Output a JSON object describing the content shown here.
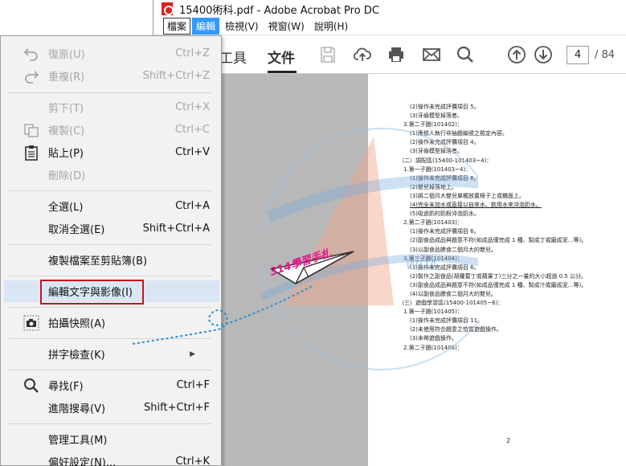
{
  "window": {
    "title": "15400術科.pdf - Adobe Acrobat Pro DC",
    "menubar": [
      "檔案",
      "編輯",
      "檢視(V)",
      "視窗(W)",
      "說明(H)"
    ]
  },
  "toolbar": {
    "tab_tools": "工具",
    "tab_document": "文件",
    "page_current": "4",
    "page_total": "/ 84"
  },
  "edit_menu": {
    "undo": {
      "label": "復原(U)",
      "shortcut": "Ctrl+Z"
    },
    "redo": {
      "label": "重複(R)",
      "shortcut": "Shift+Ctrl+Z"
    },
    "cut": {
      "label": "剪下(T)",
      "shortcut": "Ctrl+X"
    },
    "copy": {
      "label": "複製(C)",
      "shortcut": "Ctrl+C"
    },
    "paste": {
      "label": "貼上(P)",
      "shortcut": "Ctrl+V"
    },
    "delete": {
      "label": "刪除(D)",
      "shortcut": ""
    },
    "select_all": {
      "label": "全選(L)",
      "shortcut": "Ctrl+A"
    },
    "deselect_all": {
      "label": "取消全選(E)",
      "shortcut": "Shift+Ctrl+A"
    },
    "copy_file": {
      "label": "複製檔案至剪貼簿(B)",
      "shortcut": ""
    },
    "edit_text_images": {
      "label": "編輯文字與影像(I)",
      "shortcut": ""
    },
    "snapshot": {
      "label": "拍攝快照(A)",
      "shortcut": ""
    },
    "spell_check": {
      "label": "拼字檢查(K)",
      "shortcut": ""
    },
    "find": {
      "label": "尋找(F)",
      "shortcut": "Ctrl+F"
    },
    "advanced_search": {
      "label": "進階搜尋(V)",
      "shortcut": "Shift+Ctrl+F"
    },
    "manage_tools": {
      "label": "管理工具(M)",
      "shortcut": ""
    },
    "preferences": {
      "label": "偏好設定(N)...",
      "shortcut": "Ctrl+K"
    }
  },
  "pdf": {
    "lines": [
      "(2)操作未完成評價項目 5。",
      "(3)牙齒模型掉落者。",
      "3.第二子題(101402)：",
      "(1)應檢人執行非抽題編號之檢定內容。",
      "(2)操作未完成評價項目 4。",
      "(3)牙齒模型掉落者。",
      "（二）調配區(15400-101403~4)：",
      "1.第一子題(101403~4)：",
      "(1)操作未完成評價項目 6。",
      "(2)嬰兒掉落地上。",
      "(3)將二個月大嬰兒單獨放置椅子上或櫃面上。",
      "(4)完全未加水或直接以自來水、飲用水來沖泡奶水。",
      "(5)吸過奶的奶粉沖泡奶水。",
      "2.第二子題(101403)：",
      "(1)操作未完成評價項目 6。",
      "(2)副食品成品與題意不符(如成品僅完成 1 種、製成丁或磨成泥…等)。",
      "(3)以副食品餵食二個月大的嬰兒。",
      "3.第三子題(101404)：",
      "(1)操作未完成評價項目 6。",
      "(2)製作之副食品(胡蘿蔔丁或蘋果丁)三分之一量的大小超過 0.5 公分。",
      "(3)副食品成品與題意不符(如成品僅完成 1 種、製成汁或磨成泥…等)。",
      "(4)以副食品餵食二個月大的嬰兒。",
      "（三）遊戲學習區(15400-101405~6)：",
      "1.第一子題(101405)：",
      "(1)操作未完成評價項目 11。",
      "(2)未使用符合題意之恰當遊戲操作。",
      "(3)未帶遊戲操作。",
      "2.第二子題(101406)："
    ],
    "page_number": "2"
  },
  "overlay": {
    "stamp_text": "314學習手札"
  },
  "colors": {
    "menu_highlight": "#3399ff",
    "hover_row": "#dbe6f4",
    "red_box": "#c7141a",
    "stamp_pink": "#e6168c"
  }
}
